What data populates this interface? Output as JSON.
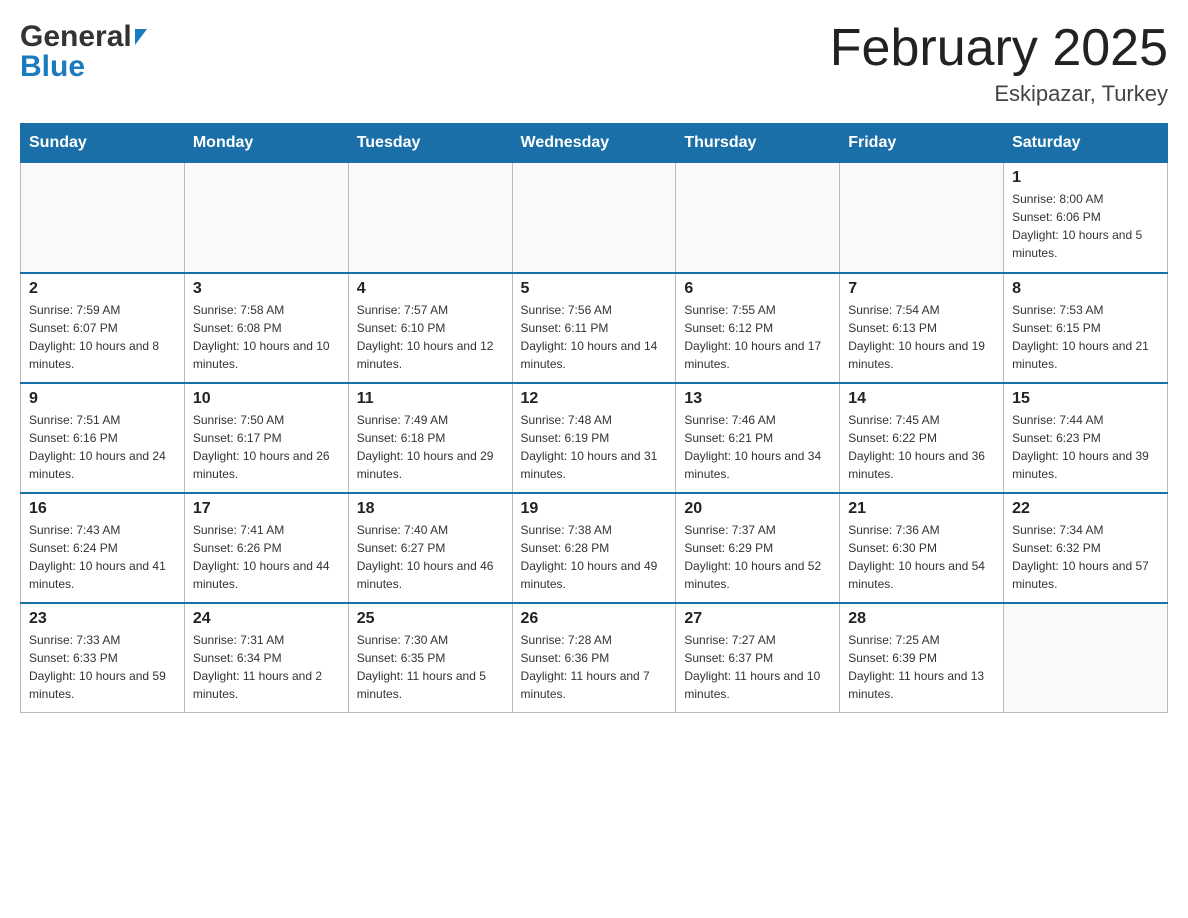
{
  "header": {
    "logo_general": "General",
    "logo_blue": "Blue",
    "month_title": "February 2025",
    "location": "Eskipazar, Turkey"
  },
  "weekdays": [
    "Sunday",
    "Monday",
    "Tuesday",
    "Wednesday",
    "Thursday",
    "Friday",
    "Saturday"
  ],
  "weeks": [
    [
      {
        "day": "",
        "info": ""
      },
      {
        "day": "",
        "info": ""
      },
      {
        "day": "",
        "info": ""
      },
      {
        "day": "",
        "info": ""
      },
      {
        "day": "",
        "info": ""
      },
      {
        "day": "",
        "info": ""
      },
      {
        "day": "1",
        "info": "Sunrise: 8:00 AM\nSunset: 6:06 PM\nDaylight: 10 hours and 5 minutes."
      }
    ],
    [
      {
        "day": "2",
        "info": "Sunrise: 7:59 AM\nSunset: 6:07 PM\nDaylight: 10 hours and 8 minutes."
      },
      {
        "day": "3",
        "info": "Sunrise: 7:58 AM\nSunset: 6:08 PM\nDaylight: 10 hours and 10 minutes."
      },
      {
        "day": "4",
        "info": "Sunrise: 7:57 AM\nSunset: 6:10 PM\nDaylight: 10 hours and 12 minutes."
      },
      {
        "day": "5",
        "info": "Sunrise: 7:56 AM\nSunset: 6:11 PM\nDaylight: 10 hours and 14 minutes."
      },
      {
        "day": "6",
        "info": "Sunrise: 7:55 AM\nSunset: 6:12 PM\nDaylight: 10 hours and 17 minutes."
      },
      {
        "day": "7",
        "info": "Sunrise: 7:54 AM\nSunset: 6:13 PM\nDaylight: 10 hours and 19 minutes."
      },
      {
        "day": "8",
        "info": "Sunrise: 7:53 AM\nSunset: 6:15 PM\nDaylight: 10 hours and 21 minutes."
      }
    ],
    [
      {
        "day": "9",
        "info": "Sunrise: 7:51 AM\nSunset: 6:16 PM\nDaylight: 10 hours and 24 minutes."
      },
      {
        "day": "10",
        "info": "Sunrise: 7:50 AM\nSunset: 6:17 PM\nDaylight: 10 hours and 26 minutes."
      },
      {
        "day": "11",
        "info": "Sunrise: 7:49 AM\nSunset: 6:18 PM\nDaylight: 10 hours and 29 minutes."
      },
      {
        "day": "12",
        "info": "Sunrise: 7:48 AM\nSunset: 6:19 PM\nDaylight: 10 hours and 31 minutes."
      },
      {
        "day": "13",
        "info": "Sunrise: 7:46 AM\nSunset: 6:21 PM\nDaylight: 10 hours and 34 minutes."
      },
      {
        "day": "14",
        "info": "Sunrise: 7:45 AM\nSunset: 6:22 PM\nDaylight: 10 hours and 36 minutes."
      },
      {
        "day": "15",
        "info": "Sunrise: 7:44 AM\nSunset: 6:23 PM\nDaylight: 10 hours and 39 minutes."
      }
    ],
    [
      {
        "day": "16",
        "info": "Sunrise: 7:43 AM\nSunset: 6:24 PM\nDaylight: 10 hours and 41 minutes."
      },
      {
        "day": "17",
        "info": "Sunrise: 7:41 AM\nSunset: 6:26 PM\nDaylight: 10 hours and 44 minutes."
      },
      {
        "day": "18",
        "info": "Sunrise: 7:40 AM\nSunset: 6:27 PM\nDaylight: 10 hours and 46 minutes."
      },
      {
        "day": "19",
        "info": "Sunrise: 7:38 AM\nSunset: 6:28 PM\nDaylight: 10 hours and 49 minutes."
      },
      {
        "day": "20",
        "info": "Sunrise: 7:37 AM\nSunset: 6:29 PM\nDaylight: 10 hours and 52 minutes."
      },
      {
        "day": "21",
        "info": "Sunrise: 7:36 AM\nSunset: 6:30 PM\nDaylight: 10 hours and 54 minutes."
      },
      {
        "day": "22",
        "info": "Sunrise: 7:34 AM\nSunset: 6:32 PM\nDaylight: 10 hours and 57 minutes."
      }
    ],
    [
      {
        "day": "23",
        "info": "Sunrise: 7:33 AM\nSunset: 6:33 PM\nDaylight: 10 hours and 59 minutes."
      },
      {
        "day": "24",
        "info": "Sunrise: 7:31 AM\nSunset: 6:34 PM\nDaylight: 11 hours and 2 minutes."
      },
      {
        "day": "25",
        "info": "Sunrise: 7:30 AM\nSunset: 6:35 PM\nDaylight: 11 hours and 5 minutes."
      },
      {
        "day": "26",
        "info": "Sunrise: 7:28 AM\nSunset: 6:36 PM\nDaylight: 11 hours and 7 minutes."
      },
      {
        "day": "27",
        "info": "Sunrise: 7:27 AM\nSunset: 6:37 PM\nDaylight: 11 hours and 10 minutes."
      },
      {
        "day": "28",
        "info": "Sunrise: 7:25 AM\nSunset: 6:39 PM\nDaylight: 11 hours and 13 minutes."
      },
      {
        "day": "",
        "info": ""
      }
    ]
  ]
}
